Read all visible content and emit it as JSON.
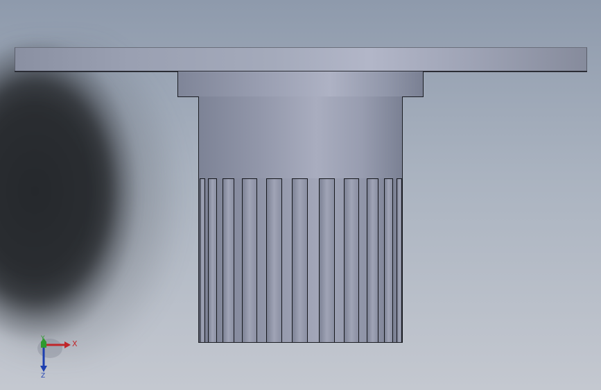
{
  "viewport": {
    "background_top": "#8e9aac",
    "background_bottom": "#c4c8d0",
    "part_color": "#9aa0b2",
    "edge_color": "#1a1c22"
  },
  "part": {
    "rib_count": 10
  },
  "triad": {
    "x_label": "X",
    "y_label": "Y",
    "z_label": "Z",
    "x_color": "#c0262a",
    "y_color": "#2f9a2f",
    "z_color": "#1d3fb0"
  }
}
